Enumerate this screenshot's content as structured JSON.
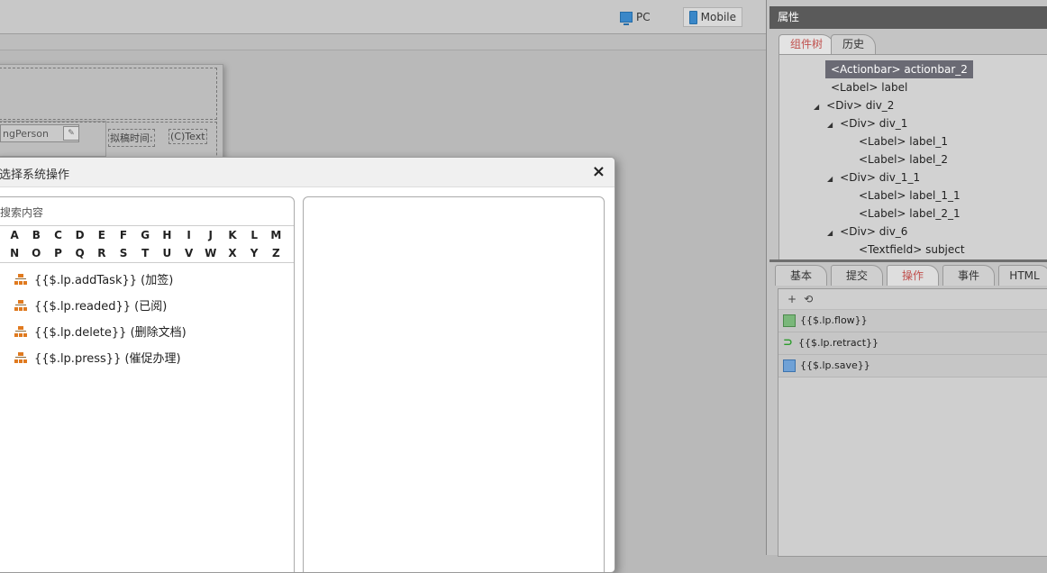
{
  "topbar": {
    "pc_label": "PC",
    "mobile_label": "Mobile"
  },
  "canvas": {
    "field_value": "ngPerson",
    "label_time": "拟稿时间:",
    "label_text": "(C)Text"
  },
  "dialog": {
    "title": "选择系统操作",
    "close": "×",
    "search_placeholder": "搜索内容",
    "letters_row1": [
      "A",
      "B",
      "C",
      "D",
      "E",
      "F",
      "G",
      "H",
      "I",
      "J",
      "K",
      "L",
      "M"
    ],
    "letters_row2": [
      "N",
      "O",
      "P",
      "Q",
      "R",
      "S",
      "T",
      "U",
      "V",
      "W",
      "X",
      "Y",
      "Z"
    ],
    "operations": [
      "{{$.lp.addTask}} (加签)",
      "{{$.lp.readed}} (已阅)",
      "{{$.lp.delete}} (删除文档)",
      "{{$.lp.press}} (催促办理)"
    ]
  },
  "props": {
    "header": "属性",
    "tree_tabs": [
      "组件树",
      "历史"
    ],
    "tree": {
      "n1": "<Actionbar> actionbar_2",
      "n2": "<Label> label",
      "n3": "<Div> div_2",
      "n4": "<Div> div_1",
      "n5": "<Label> label_1",
      "n6": "<Label> label_2",
      "n7": "<Div> div_1_1",
      "n8": "<Label> label_1_1",
      "n9": "<Label> label_2_1",
      "n10": "<Div> div_6",
      "n11": "<Textfield> subject"
    },
    "prop_tabs": [
      "基本",
      "提交",
      "操作",
      "事件",
      "HTML"
    ],
    "toolbar": {
      "add": "+",
      "history": "⟲"
    },
    "actions": [
      {
        "label": "{{$.lp.flow}}",
        "icon": "flow-icon"
      },
      {
        "label": "{{$.lp.retract}}",
        "icon": "retract-icon"
      },
      {
        "label": "{{$.lp.save}}",
        "icon": "save-icon"
      }
    ]
  }
}
